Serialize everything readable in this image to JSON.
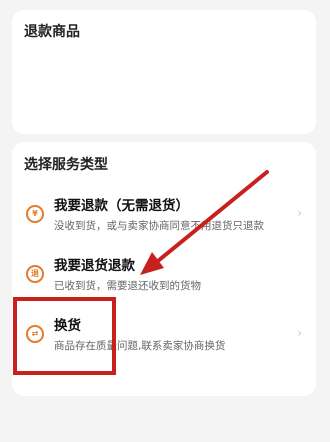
{
  "refund_items": {
    "title": "退款商品"
  },
  "service_type": {
    "title": "选择服务类型",
    "options": [
      {
        "icon": "refund-only-icon",
        "icon_glyph": "¥",
        "title": "我要退款（无需退货）",
        "desc": "没收到货，或与卖家协商同意不用退货只退款"
      },
      {
        "icon": "return-refund-icon",
        "icon_glyph": "退",
        "title": "我要退货退款",
        "desc": "已收到货，需要退还收到的货物"
      },
      {
        "icon": "exchange-icon",
        "icon_glyph": "⇄",
        "title": "换货",
        "desc": "商品存在质量问题,联系卖家协商换货"
      }
    ]
  },
  "colors": {
    "accent": "#e47a2a",
    "annotation": "#c8201d",
    "background": "#f4f4f4"
  }
}
